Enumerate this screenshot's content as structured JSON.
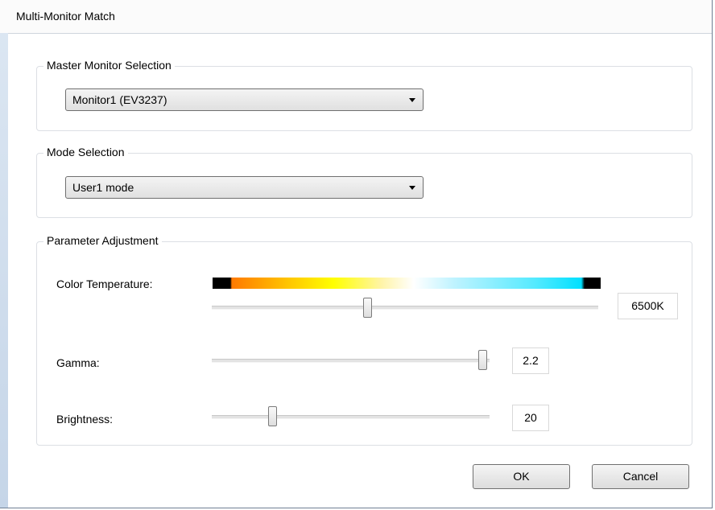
{
  "window": {
    "title": "Multi-Monitor Match"
  },
  "master_monitor": {
    "label": "Master Monitor Selection",
    "selected": "Monitor1 (EV3237)"
  },
  "mode": {
    "label": "Mode Selection",
    "selected": "User1 mode"
  },
  "parameters": {
    "label": "Parameter Adjustment",
    "color_temperature": {
      "label": "Color Temperature:",
      "value": "6500K",
      "slider_fraction": 0.4
    },
    "gamma": {
      "label": "Gamma:",
      "value": "2.2",
      "slider_fraction": 0.99
    },
    "brightness": {
      "label": "Brightness:",
      "value": "20",
      "slider_fraction": 0.21
    }
  },
  "buttons": {
    "ok": "OK",
    "cancel": "Cancel"
  }
}
